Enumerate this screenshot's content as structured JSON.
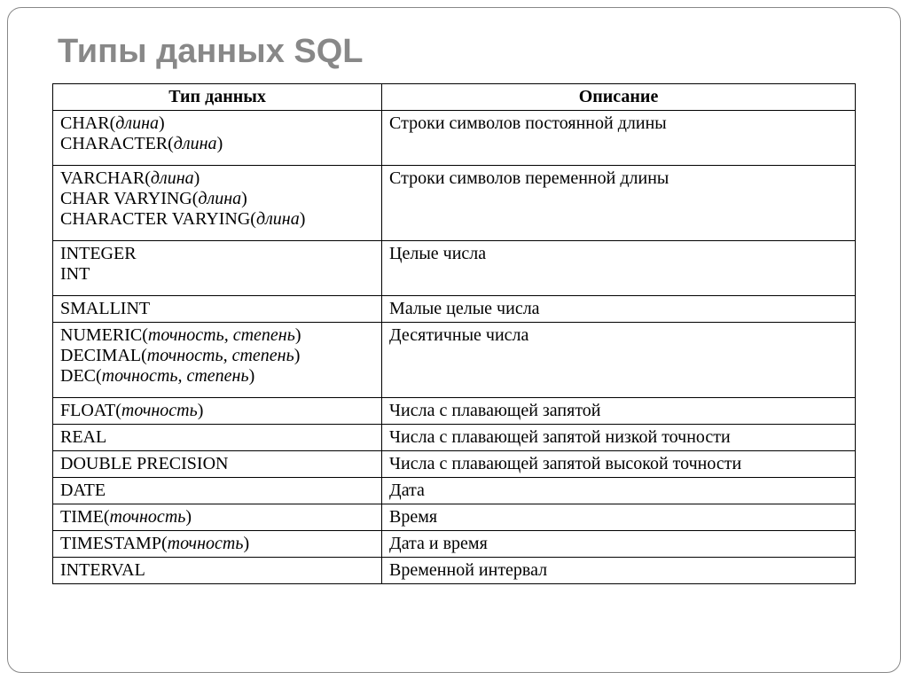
{
  "title": "Типы данных SQL",
  "headers": {
    "col1": "Тип данных",
    "col2": "Описание"
  },
  "rows": [
    {
      "types": [
        {
          "prefix": "CHAR(",
          "italic": "длина",
          "suffix": ")"
        },
        {
          "prefix": "CHARACTER(",
          "italic": "длина",
          "suffix": ")"
        }
      ],
      "desc": "Строки символов постоянной длины",
      "multi": true
    },
    {
      "types": [
        {
          "prefix": "VARCHAR(",
          "italic": "длина",
          "suffix": ")"
        },
        {
          "prefix": "CHAR VARYING(",
          "italic": "длина",
          "suffix": ")"
        },
        {
          "prefix": "CHARACTER VARYING(",
          "italic": "длина",
          "suffix": ")"
        }
      ],
      "desc": "Строки символов переменной длины",
      "multi": true
    },
    {
      "types": [
        {
          "prefix": "INTEGER"
        },
        {
          "prefix": "INT"
        }
      ],
      "desc": "Целые числа",
      "multi": true
    },
    {
      "types": [
        {
          "prefix": "SMALLINT"
        }
      ],
      "desc": "Малые целые числа"
    },
    {
      "types": [
        {
          "prefix": "NUMERIC(",
          "italic": "точность, степень",
          "suffix": ")"
        },
        {
          "prefix": "DECIMAL(",
          "italic": "точность, степень",
          "suffix": ")"
        },
        {
          "prefix": "DEC(",
          "italic": "точность, степень",
          "suffix": ")"
        }
      ],
      "desc": "Десятичные числа",
      "multi": true
    },
    {
      "types": [
        {
          "prefix": "FLOAT(",
          "italic": "точность",
          "suffix": ")"
        }
      ],
      "desc": "Числа с плавающей запятой"
    },
    {
      "types": [
        {
          "prefix": "REAL"
        }
      ],
      "desc": "Числа с плавающей запятой низкой точности"
    },
    {
      "types": [
        {
          "prefix": "DOUBLE PRECISION"
        }
      ],
      "desc": "Числа с плавающей запятой высокой точности"
    },
    {
      "types": [
        {
          "prefix": "DATE"
        }
      ],
      "desc": "Дата"
    },
    {
      "types": [
        {
          "prefix": "TIME(",
          "italic": "точность",
          "suffix": ")"
        }
      ],
      "desc": "Время"
    },
    {
      "types": [
        {
          "prefix": "TIMESTAMP(",
          "italic": "точность",
          "suffix": ")"
        }
      ],
      "desc": "Дата и время"
    },
    {
      "types": [
        {
          "prefix": "INTERVAL"
        }
      ],
      "desc": "Временной интервал"
    }
  ]
}
